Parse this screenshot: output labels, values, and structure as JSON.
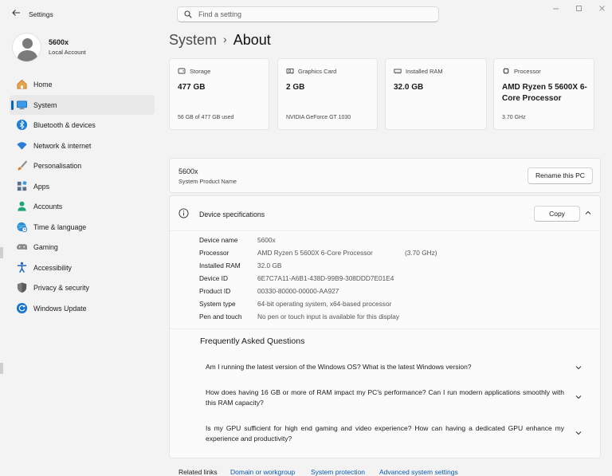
{
  "window": {
    "title": "Settings"
  },
  "search": {
    "placeholder": "Find a setting"
  },
  "account": {
    "name": "5600x",
    "type": "Local Account"
  },
  "nav": [
    {
      "label": "Home",
      "icon": "home-icon",
      "color": "#d9822b"
    },
    {
      "label": "System",
      "icon": "monitor-icon",
      "color": "#0f7bd7",
      "active": true
    },
    {
      "label": "Bluetooth & devices",
      "icon": "bluetooth-icon",
      "color": "#0f7bd7"
    },
    {
      "label": "Network & internet",
      "icon": "wifi-icon",
      "color": "#2b6fd9"
    },
    {
      "label": "Personalisation",
      "icon": "brush-icon",
      "color": "#c9762c"
    },
    {
      "label": "Apps",
      "icon": "apps-icon",
      "color": "#5a6f8a"
    },
    {
      "label": "Accounts",
      "icon": "person-icon",
      "color": "#1aa86c"
    },
    {
      "label": "Time & language",
      "icon": "globe-clock-icon",
      "color": "#1f8ad6"
    },
    {
      "label": "Gaming",
      "icon": "gamepad-icon",
      "color": "#7a7a7a"
    },
    {
      "label": "Accessibility",
      "icon": "accessibility-icon",
      "color": "#1864c4"
    },
    {
      "label": "Privacy & security",
      "icon": "shield-icon",
      "color": "#6e6e6e"
    },
    {
      "label": "Windows Update",
      "icon": "update-icon",
      "color": "#1674d1"
    }
  ],
  "breadcrumb": {
    "parent": "System",
    "separator": "›",
    "current": "About"
  },
  "summary": [
    {
      "label": "Storage",
      "value": "477 GB",
      "sub": "56 GB of 477 GB used",
      "icon": "storage-icon"
    },
    {
      "label": "Graphics Card",
      "value": "2 GB",
      "sub": "NVIDIA GeForce GT 1030",
      "icon": "graphics-card-icon"
    },
    {
      "label": "Installed RAM",
      "value": "32.0 GB",
      "sub": "",
      "icon": "ram-icon"
    },
    {
      "label": "Processor",
      "value": "AMD Ryzen 5 5600X 6-Core Processor",
      "sub": "3.70 GHz",
      "icon": "processor-icon"
    }
  ],
  "pc": {
    "name": "5600x",
    "subtitle": "System Product Name",
    "rename_label": "Rename this PC"
  },
  "device_specs": {
    "title": "Device specifications",
    "copy_label": "Copy",
    "rows": [
      {
        "key": "Device name",
        "value": "5600x",
        "extra": ""
      },
      {
        "key": "Processor",
        "value": "AMD Ryzen 5 5600X 6-Core Processor",
        "extra": "(3.70 GHz)"
      },
      {
        "key": "Installed RAM",
        "value": "32.0 GB",
        "extra": ""
      },
      {
        "key": "Device ID",
        "value": "6E7C7A11-A6B1-438D-99B9-308DDD7E01E4",
        "extra": ""
      },
      {
        "key": "Product ID",
        "value": "00330-80000-00000-AA927",
        "extra": ""
      },
      {
        "key": "System type",
        "value": "64-bit operating system, x64-based processor",
        "extra": ""
      },
      {
        "key": "Pen and touch",
        "value": "No pen or touch input is available for this display",
        "extra": ""
      }
    ]
  },
  "faq": {
    "title": "Frequently Asked Questions",
    "items": [
      "Am I running the latest version of the Windows OS? What is the latest Windows version?",
      "How does having 16 GB or more of RAM impact my PC's performance? Can I run modern applications smoothly with this RAM capacity?",
      "Is my GPU sufficient for high end gaming and video experience? How can having a dedicated GPU enhance my experience and productivity?"
    ]
  },
  "related": {
    "label": "Related links",
    "links": [
      "Domain or workgroup",
      "System protection",
      "Advanced system settings"
    ]
  },
  "colors": {
    "accent": "#0067c0",
    "link": "#0a5ab3",
    "card": "#fbfbfb",
    "background": "#f3f3f3"
  }
}
